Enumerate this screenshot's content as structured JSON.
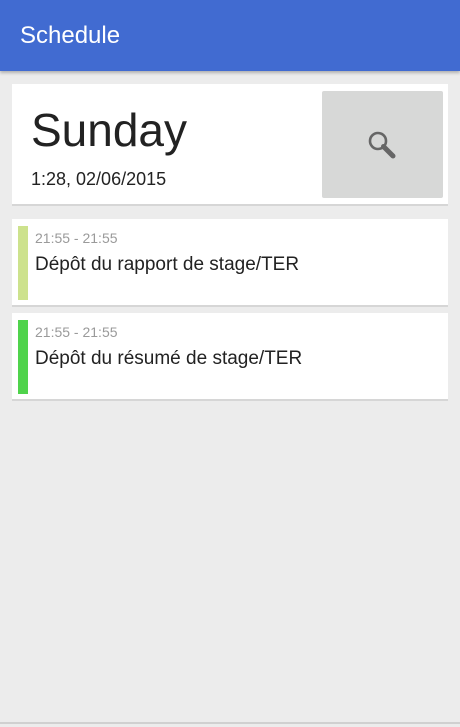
{
  "appbar": {
    "title": "Schedule",
    "color": "#416bd1"
  },
  "day_card": {
    "day": "Sunday",
    "datetime": "1:28, 02/06/2015",
    "search_icon": "search-icon"
  },
  "events": [
    {
      "time": "21:55 - 21:55",
      "title": "Dépôt du rapport de stage/TER",
      "color": "#cde28d"
    },
    {
      "time": "21:55 - 21:55",
      "title": "Dépôt du résumé de stage/TER",
      "color": "#4fd34b"
    }
  ]
}
